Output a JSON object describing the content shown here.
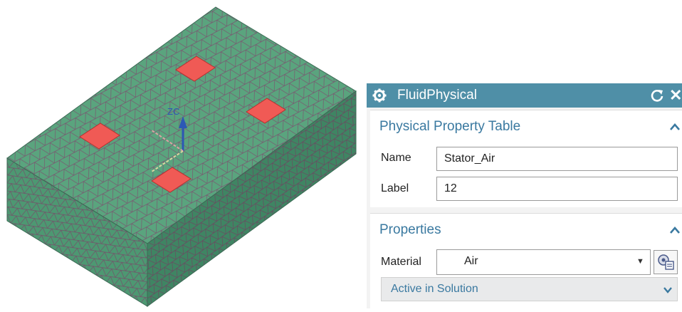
{
  "viewport": {
    "axis_label": "ZC",
    "mesh_fill": "#5aa47e",
    "mesh_line": "#7a5670",
    "pad_fill": "#f05a55"
  },
  "dialog": {
    "title": "FluidPhysical",
    "titlebar_color": "#4f8fa7",
    "icons": [
      "gear-icon",
      "reset-icon",
      "close-icon"
    ],
    "close_glyph": "✕",
    "physical_section": {
      "heading": "Physical Property Table",
      "name_label": "Name",
      "name_value": "Stator_Air",
      "label_label": "Label",
      "label_value": "12"
    },
    "properties_section": {
      "heading": "Properties",
      "material_label": "Material",
      "material_value": "Air",
      "active_in_solution": "Active in Solution"
    }
  }
}
